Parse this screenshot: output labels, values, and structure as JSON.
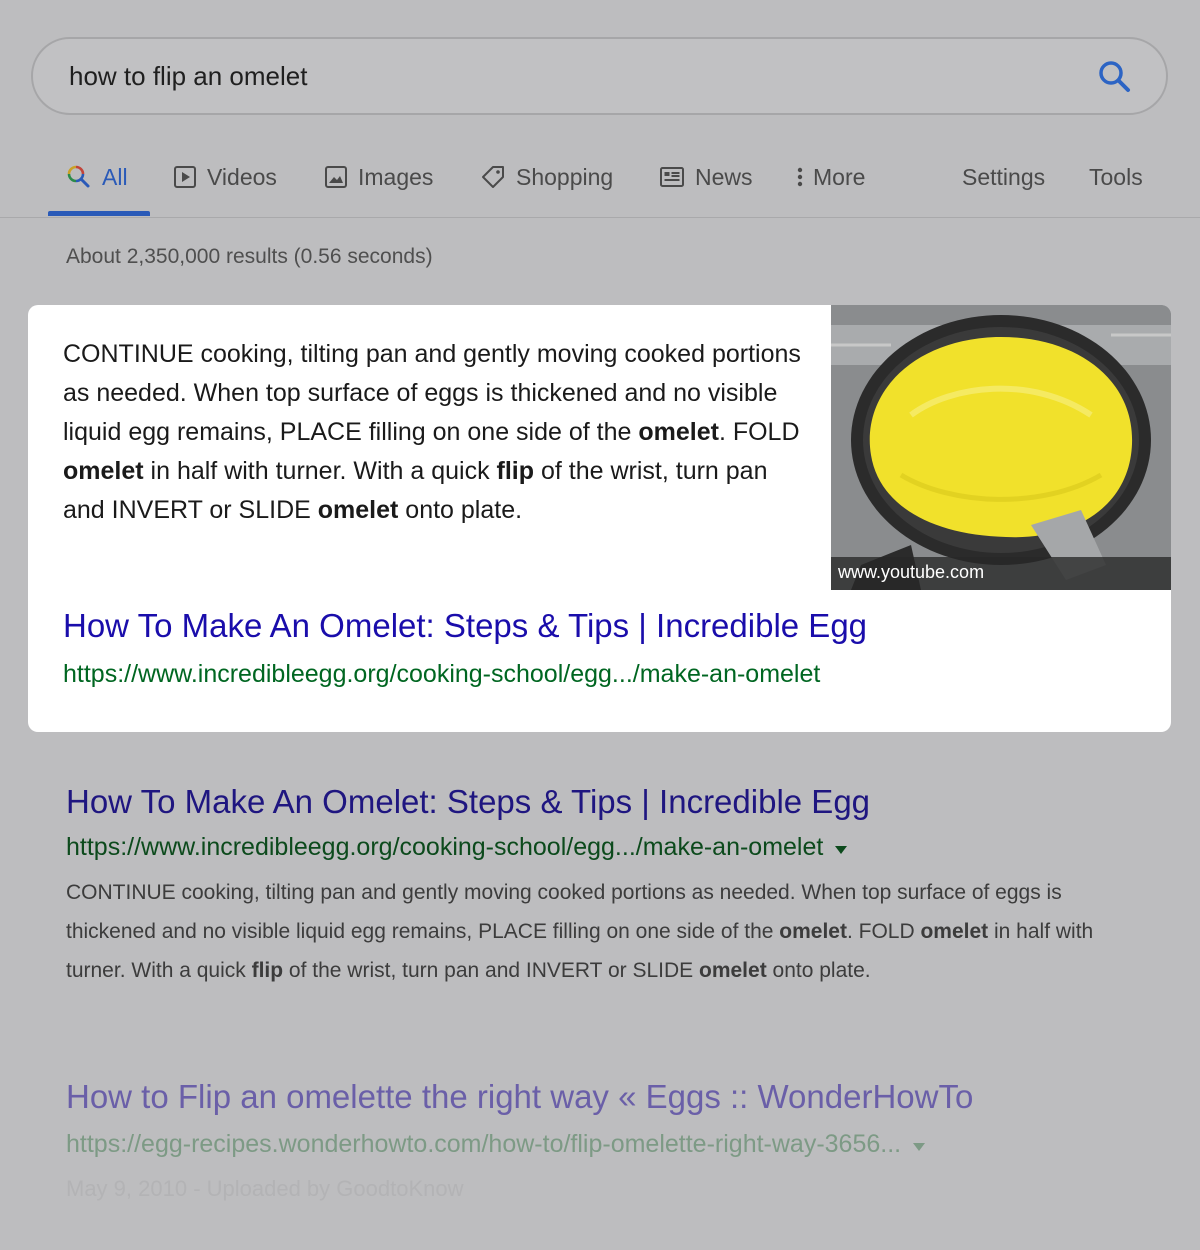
{
  "search": {
    "query": "how to flip an omelet",
    "search_icon": "search-icon"
  },
  "tabs": {
    "all": "All",
    "videos": "Videos",
    "images": "Images",
    "shopping": "Shopping",
    "news": "News",
    "more": "More",
    "settings": "Settings",
    "tools": "Tools"
  },
  "stats": "About 2,350,000 results (0.56 seconds)",
  "featured_snippet": {
    "text_parts": [
      "CONTINUE cooking, tilting pan and gently moving cooked portions as needed. When top surface of eggs is thickened and no visible liquid egg remains, PLACE filling on one side of the ",
      "omelet",
      ". FOLD ",
      "omelet",
      " in half with turner. With a quick ",
      "flip",
      " of the wrist, turn pan and INVERT or SLIDE ",
      "omelet",
      " onto plate."
    ],
    "image_source": "www.youtube.com",
    "title": "How To Make An Omelet: Steps & Tips | Incredible Egg",
    "url": "https://www.incredibleegg.org/cooking-school/egg.../make-an-omelet"
  },
  "results": [
    {
      "title": "How To Make An Omelet: Steps & Tips | Incredible Egg",
      "url": "https://www.incredibleegg.org/cooking-school/egg.../make-an-omelet",
      "desc_parts": [
        "CONTINUE cooking, tilting pan and gently moving cooked portions as needed. When top surface of eggs is thickened and no visible liquid egg remains, PLACE filling on one side of the ",
        "omelet",
        ". FOLD ",
        "omelet",
        " in half with turner. With a quick ",
        "flip",
        " of the wrist, turn pan and INVERT or SLIDE ",
        "omelet",
        " onto plate."
      ]
    },
    {
      "title": "How to Flip an omelette the right way « Eggs :: WonderHowTo",
      "url": "https://egg-recipes.wonderhowto.com/how-to/flip-omelette-right-way-3656...",
      "meta": "May 9, 2010 - Uploaded by GoodtoKnow"
    }
  ],
  "colors": {
    "accent": "#2a5ab8",
    "link": "#1a0dab",
    "url_green": "#006621",
    "overlay_bg": "#bdbdbf"
  }
}
